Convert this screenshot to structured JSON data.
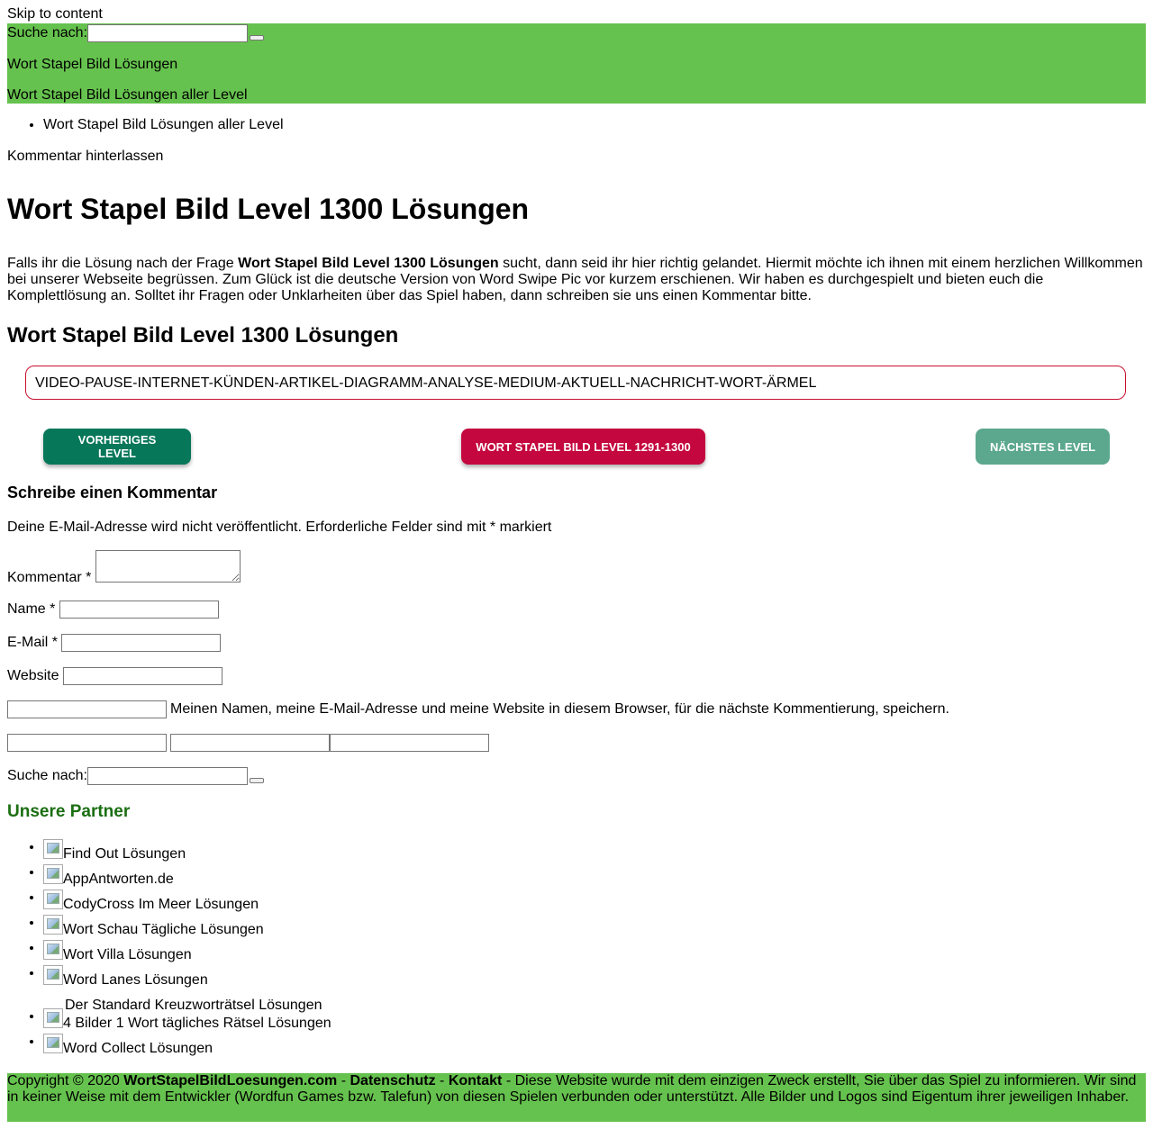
{
  "skip_link": "Skip to content",
  "header": {
    "search_label": "Suche nach:",
    "site_title": "Wort Stapel Bild Lösungen",
    "site_subtitle": "Wort Stapel Bild Lösungen aller Level"
  },
  "menu": {
    "items": [
      "Wort Stapel Bild Lösungen aller Level"
    ]
  },
  "comment_link": "Kommentar hinterlassen",
  "article": {
    "title": "Wort Stapel Bild Level 1300 Lösungen",
    "intro_pre": "Falls ihr die Lösung nach der Frage ",
    "intro_bold": "Wort Stapel Bild Level 1300 Lösungen",
    "intro_post": " sucht, dann seid ihr hier richtig gelandet. Hiermit möchte ich ihnen mit einem herzlichen Willkommen bei unserer Webseite begrüssen. Zum Glück ist die deutsche Version von Word Swipe Pic vor kurzem erschienen. Wir haben es durchgespielt und bieten euch die Komplettlösung an. Solltet ihr Fragen oder Unklarheiten über das Spiel haben, dann schreiben sie uns einen Kommentar bitte.",
    "subtitle": "Wort Stapel Bild Level 1300 Lösungen",
    "answer": "VIDEO-PAUSE-INTERNET-KÜNDEN-ARTIKEL-DIAGRAMM-ANALYSE-MEDIUM-AKTUELL-NACHRICHT-WORT-ÄRMEL"
  },
  "nav_buttons": {
    "prev": "VORHERIGES LEVEL",
    "group": "WORT STAPEL BILD LEVEL 1291-1300",
    "next": "NÄCHSTES LEVEL"
  },
  "comment_form": {
    "heading": "Schreibe einen Kommentar",
    "notice": "Deine E-Mail-Adresse wird nicht veröffentlicht. Erforderliche Felder sind mit * markiert",
    "comment_label": "Kommentar *",
    "name_label": "Name *",
    "email_label": "E-Mail *",
    "website_label": "Website",
    "save_label": "Meinen Namen, meine E-Mail-Adresse und meine Website in diesem Browser, für die nächste Kommentierung, speichern."
  },
  "sidebar": {
    "search_label": "Suche nach:",
    "partners_title": "Unsere Partner",
    "partners": [
      "Find Out Lösungen",
      "AppAntworten.de",
      "CodyCross Im Meer Lösungen",
      "Wort Schau Tägliche Lösungen",
      "Wort Villa Lösungen",
      "Word Lanes Lösungen",
      "Der Standard Kreuzworträtsel Lösungen",
      "4 Bilder 1 Wort tägliches Rätsel Lösungen",
      "Word Collect Lösungen"
    ]
  },
  "footer": {
    "copyright": "Copyright © 2020 ",
    "site": "WortStapelBildLoesungen.com",
    "sep": "  -  ",
    "privacy": "Datenschutz",
    "contact": "Kontakt",
    "disclaimer": "  - Diese Website wurde mit dem einzigen Zweck erstellt, Sie über das Spiel zu informieren. Wir sind in keiner Weise mit dem Entwickler (Wordfun Games bzw. Talefun) von diesen Spielen verbunden oder unterstützt. Alle Bilder und Logos sind Eigentum ihrer jeweiligen Inhaber."
  },
  "colors": {
    "header_bg": "#66c24e",
    "btn_prev": "#07775a",
    "btn_group": "#c4073e",
    "btn_next": "#5ca88e",
    "answer_border": "#c8102e",
    "sidebar_title": "#1b6e12"
  }
}
